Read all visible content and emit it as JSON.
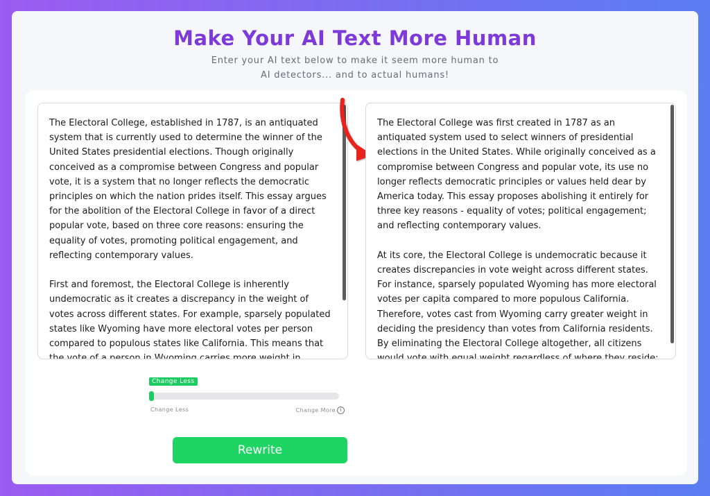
{
  "header": {
    "title": "Make Your AI Text More Human",
    "subtitle": "Enter your AI text below to make it seem more human to AI detectors... and to actual humans!"
  },
  "input_text": "The Electoral College, established in 1787, is an antiquated system that is currently used to determine the winner of the United States presidential elections. Though originally conceived as a compromise between Congress and popular vote, it is a system that no longer reflects the democratic principles on which the nation prides itself. This essay argues for the abolition of the Electoral College in favor of a direct popular vote, based on three core reasons: ensuring the equality of votes, promoting political engagement, and reflecting contemporary values.\n\nFirst and foremost, the Electoral College is inherently undemocratic as it creates a discrepancy in the weight of votes across different states. For example, sparsely populated states like Wyoming have more electoral votes per person compared to populous states like California. This means that the vote of a person in Wyoming carries more weight in deciding the presidency than a vote from someone in California. Abolishing the Electoral College would ensure that each",
  "output_text": "The Electoral College was first created in 1787 as an antiquated system used to select winners of presidential elections in the United States. While originally conceived as a compromise between Congress and popular vote, its use no longer reflects democratic principles or values held dear by America today. This essay proposes abolishing it entirely for three key reasons - equality of votes; political engagement; and reflecting contemporary values.\n\nAt its core, the Electoral College is undemocratic because it creates discrepancies in vote weight across different states. For instance, sparsely populated Wyoming has more electoral votes per capita compared to more populous California. Therefore, votes cast from Wyoming carry greater weight in deciding the presidency than votes from California residents. By eliminating the Electoral College altogether, all citizens would vote with equal weight regardless of where they reside; adhering to democratic principles that emphasize individual vote value and impact.",
  "slider": {
    "badge": "Change Less",
    "min_label": "Change Less",
    "max_label": "Change More",
    "value_fraction": 0.0,
    "info_icon": "info-icon"
  },
  "rewrite_button": {
    "label": "Rewrite"
  },
  "colors": {
    "title": "#7d3ad8",
    "accent_green": "#1ed462",
    "arrow": "#e8241d"
  }
}
